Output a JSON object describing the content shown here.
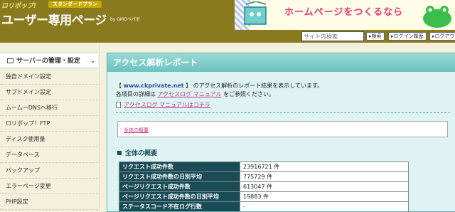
{
  "header": {
    "brand_top": "ロリポップ!",
    "plan": "スタンダードプラン",
    "brand_main": "ユーザー専用ページ",
    "by": "by GMOペパボ",
    "banner_text": "ホームページをつくるなら"
  },
  "toolbar": {
    "search_placeholder": "サイト内検索",
    "search_button": "検索",
    "login_history": "ログイン履歴",
    "logout": "ログアウ"
  },
  "sidebar": {
    "section_label": "サーバーの管理・設定",
    "items": [
      "独自ドメイン設定",
      "サブドメイン設定",
      "ムームーDNSへ移行",
      "ロリポップ！FTP",
      "ディスク使用量",
      "データベース",
      "バックアップ",
      "エラーページ変更",
      "PHP設定"
    ]
  },
  "main": {
    "title": "アクセス解析レポート",
    "intro_prefix": "【 ",
    "intro_domain": "www.ckprivate.net",
    "intro_mid": " 】 のアクセス解析のレポート結果を表示しています。",
    "intro_line2_pre": "各項目の詳細は",
    "intro_line2_link": "アクセスログ マニュアル",
    "intro_line2_post": "をご参照ください。",
    "manual_link": "アクセスログ マニュアルはコチラ",
    "toc_link": "全体の概要",
    "section_title": "全体の概要",
    "stats": [
      {
        "key": "リクエスト成功件数",
        "value": "23916721 件"
      },
      {
        "key": "リクエスト成功件数の日別平均",
        "value": "775729 件"
      },
      {
        "key": "ページリクエスト成功件数",
        "value": "613047 件"
      },
      {
        "key": "ページリクエスト成功件数の日別平均",
        "value": "19883 件"
      },
      {
        "key": "ステータスコード不在ログ行数",
        "value": "-"
      }
    ]
  },
  "colors": {
    "header_bg": "#8a7a1e",
    "main_title_bg": "#6cc2bf",
    "table_key_bg": "#1a4c57",
    "link": "#c0398b"
  }
}
